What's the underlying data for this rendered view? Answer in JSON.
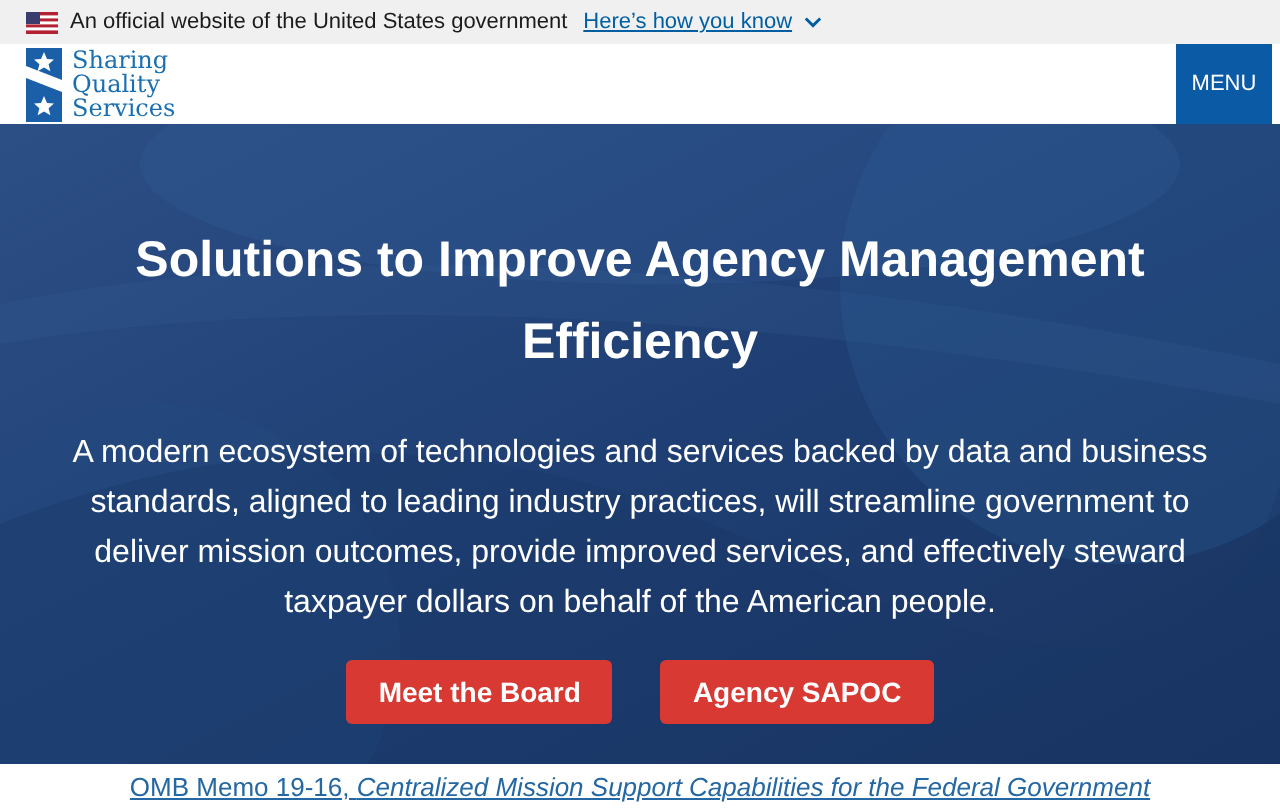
{
  "gov_banner": {
    "text": "An official website of the United States government",
    "link": "Here’s how you know",
    "expanded": false
  },
  "header": {
    "logo_lines": [
      "Sharing",
      "Quality",
      "Services"
    ],
    "menu_button": "MENU"
  },
  "hero": {
    "title": "Solutions to Improve Agency Management Efficiency",
    "description": "A modern ecosystem of technologies and services backed by data and business standards, aligned to leading industry practices, will streamline government to deliver mission outcomes, provide improved services, and effectively steward taxpayer dollars on behalf of the American people.",
    "buttons": [
      "Meet the Board",
      "Agency SAPOC"
    ]
  },
  "footer_link": "OMB Memo 19-16, *Centralized Mission Support Capabilities for the Federal Government*"
}
